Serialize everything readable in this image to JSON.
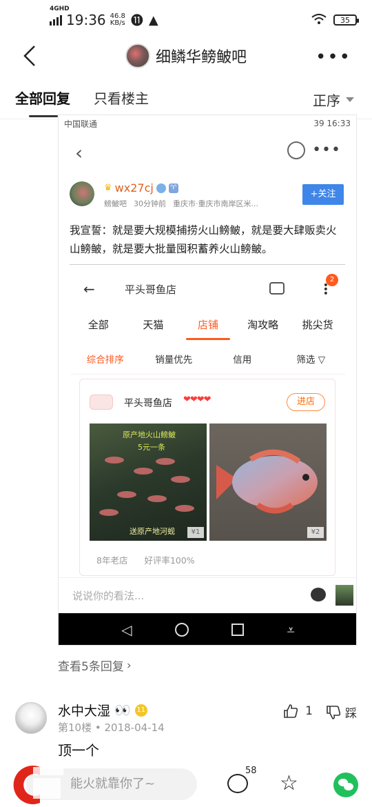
{
  "status_bar": {
    "network": "4GHD",
    "time": "19:36",
    "speed_value": "46.8",
    "speed_unit": "KB/s",
    "battery": "35"
  },
  "nav": {
    "title": "细鳞华鳑鲏吧"
  },
  "tabs": {
    "all": "全部回复",
    "op_only": "只看楼主",
    "sort": "正序"
  },
  "embedded": {
    "carrier": "中国联通",
    "status_right": "39 16:33",
    "user": {
      "name": "wx27cj",
      "bar": "鳑鲏吧",
      "time": "30分钟前",
      "location": "重庆市·重庆市南岸区米...",
      "follow_label": "+关注"
    },
    "post_text": "我宣誓：就是要大规模捕捞火山鳑鲏，就是要大肆贩卖火山鳑鲏，就是要大批量囤积蓄养火山鳑鲏。",
    "shop_page": {
      "query": "平头哥鱼店",
      "badge": "2",
      "tabs": [
        "全部",
        "天猫",
        "店铺",
        "淘攻略",
        "挑尖货"
      ],
      "active_tab": 2,
      "sort_options": [
        "综合排序",
        "销量优先",
        "信用",
        "筛选"
      ],
      "card": {
        "shop_name": "平头哥鱼店",
        "hearts": "❤❤❤❤",
        "enter_label": "进店",
        "photo1_caption_top": "原产地火山鳑鲏",
        "photo1_caption_price": "5元一条",
        "photo1_caption_bottom": "送原产地河蚬",
        "photo1_price": "¥1",
        "photo2_price": "¥2",
        "tag_age": "8年老店",
        "tag_rating": "好评率100%"
      }
    },
    "comment_placeholder": "说说你的看法..."
  },
  "view_replies": "查看5条回复",
  "reply": {
    "name": "水中大湿",
    "emoji": "👀",
    "level": "11",
    "floor": "第10楼",
    "date": "2018-04-14",
    "text": "顶一个",
    "likes": "1",
    "dislike_label": "踩"
  },
  "bottom_bar": {
    "input_placeholder": "能火就靠你了~",
    "comment_count": "58"
  }
}
